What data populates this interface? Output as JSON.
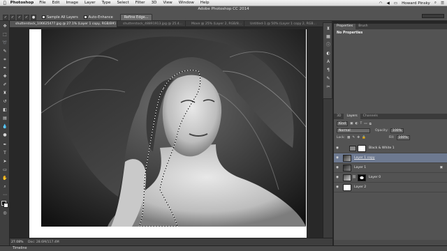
{
  "menubar": {
    "apple": "",
    "app": "Photoshop",
    "items": [
      "File",
      "Edit",
      "Image",
      "Layer",
      "Type",
      "Select",
      "Filter",
      "3D",
      "View",
      "Window",
      "Help"
    ],
    "user": "Howard Pinsky",
    "clock": "Thu 1:52 PM"
  },
  "options": {
    "window_title": "Adobe Photoshop CC 2014",
    "sample_all_layers": "Sample All Layers",
    "auto_enhance": "Auto-Enhance",
    "refine_edge": "Refine Edge..."
  },
  "tabs": [
    "shutterstock_106625477.jpg @ 27.1% (Layer 1 copy, RGB/8#)",
    "shutterstock_48891913.jpg @ 25.4...",
    "Move @ 25% (Layer 2, RGB/8...",
    "Untitled-1 @ 50% (Layer 1 copy 2, RGB..."
  ],
  "status": {
    "zoom": "27.08%",
    "doc": "Doc: 28.6M/117.4M"
  },
  "timeline": "Timeline",
  "properties": {
    "tab_active": "Properties",
    "tab_other": "Brush",
    "empty_label": "No Properties"
  },
  "layers_panel": {
    "tabs": [
      "3D",
      "Layers",
      "Channels"
    ],
    "filter": "Kind",
    "blend_mode": "Normal",
    "opacity_label": "Opacity:",
    "opacity": "100%",
    "lock_label": "Lock:",
    "fill_label": "Fill:",
    "fill": "100%",
    "layers": [
      {
        "name": "Black & White 1"
      },
      {
        "name": "Layer 1 copy"
      },
      {
        "name": "Layer 1"
      },
      {
        "name": "Layer 0"
      },
      {
        "name": "Layer 2"
      }
    ]
  }
}
